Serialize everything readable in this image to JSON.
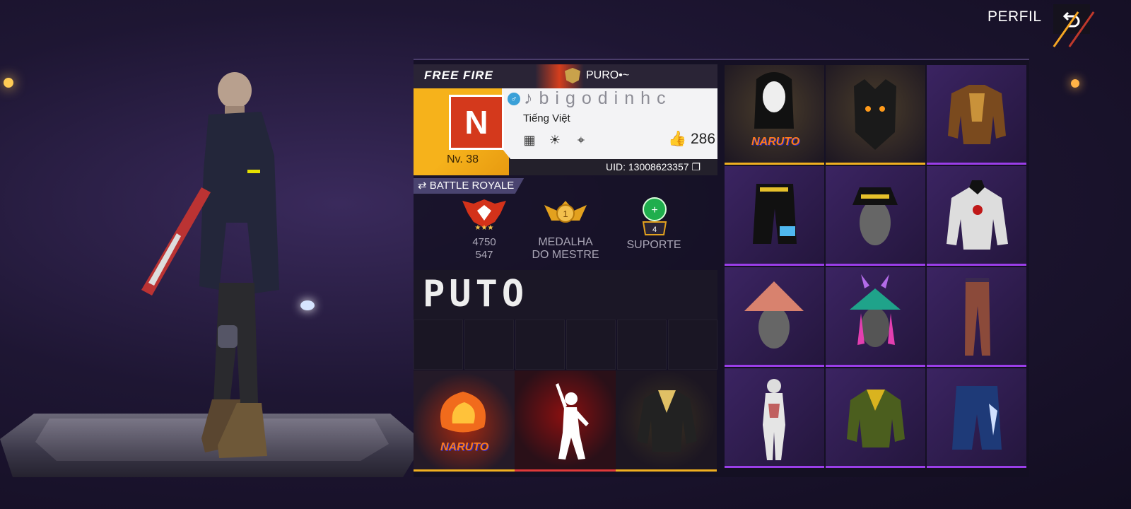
{
  "header": {
    "title": "PERFIL"
  },
  "profile": {
    "logo": "FREE FIRE",
    "guild": "PURO•~",
    "avatar_letter": "N",
    "level": "Nv. 38",
    "nickname": "♪bigodinhc",
    "language": "Tiếng Việt",
    "likes": "286",
    "uid": "UID: 13008623357"
  },
  "battle": {
    "mode": "BATTLE ROYALE",
    "rank_points": "4750",
    "rank_sub": "547",
    "medal_line1": "MEDALHA",
    "medal_line2": "DO MESTRE",
    "medal_level": "1",
    "support_count": "4",
    "support_label": "SUPORTE"
  },
  "title_banner": "PUTO",
  "naruto_tag": "NARUTO",
  "colors": {
    "accent_yellow": "#f6b21b",
    "accent_purple": "#9a3ee8",
    "accent_red": "#d4391c"
  }
}
